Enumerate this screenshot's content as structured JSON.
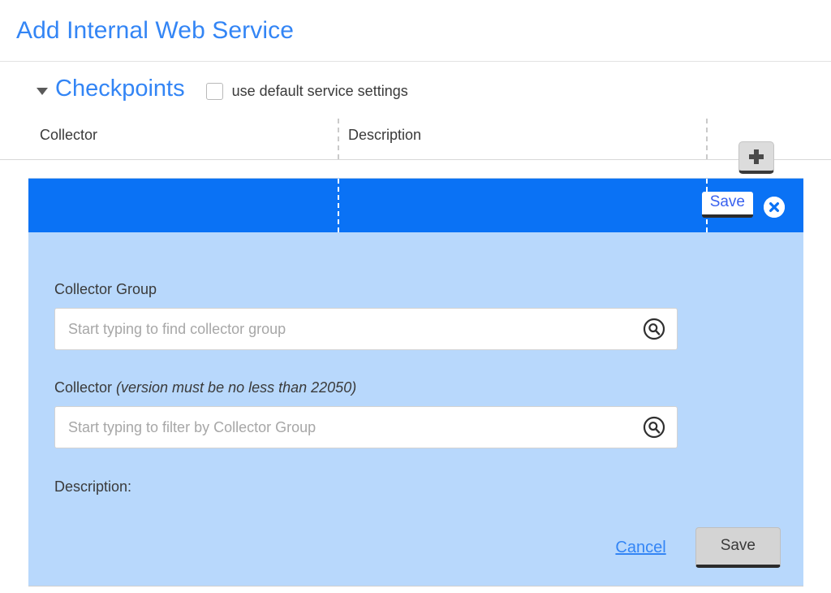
{
  "page": {
    "title": "Add Internal Web Service"
  },
  "section": {
    "title": "Checkpoints",
    "collapse_icon": "triangle-down-icon",
    "default_settings_label": "use default service settings",
    "default_settings_checked": false
  },
  "table": {
    "columns": [
      "Collector",
      "Description"
    ],
    "add_icon": "plus-icon"
  },
  "selected_row": {
    "save_label": "Save",
    "close_icon": "close-circle-icon"
  },
  "detail_panel": {
    "collector_group": {
      "label": "Collector Group",
      "placeholder": "Start typing to find collector group",
      "value": "",
      "search_icon": "search-icon"
    },
    "collector": {
      "label": "Collector ",
      "label_note": "(version must be no less than 22050)",
      "placeholder": "Start typing to filter by Collector Group",
      "value": "",
      "search_icon": "search-icon"
    },
    "description": {
      "label": "Description:"
    },
    "cancel_label": "Cancel",
    "save_label": "Save"
  },
  "colors": {
    "accent_blue": "#3385f5",
    "row_blue": "#0a72f5",
    "panel_blue": "#b8d8fc",
    "text_dark": "#3a3a3a"
  }
}
